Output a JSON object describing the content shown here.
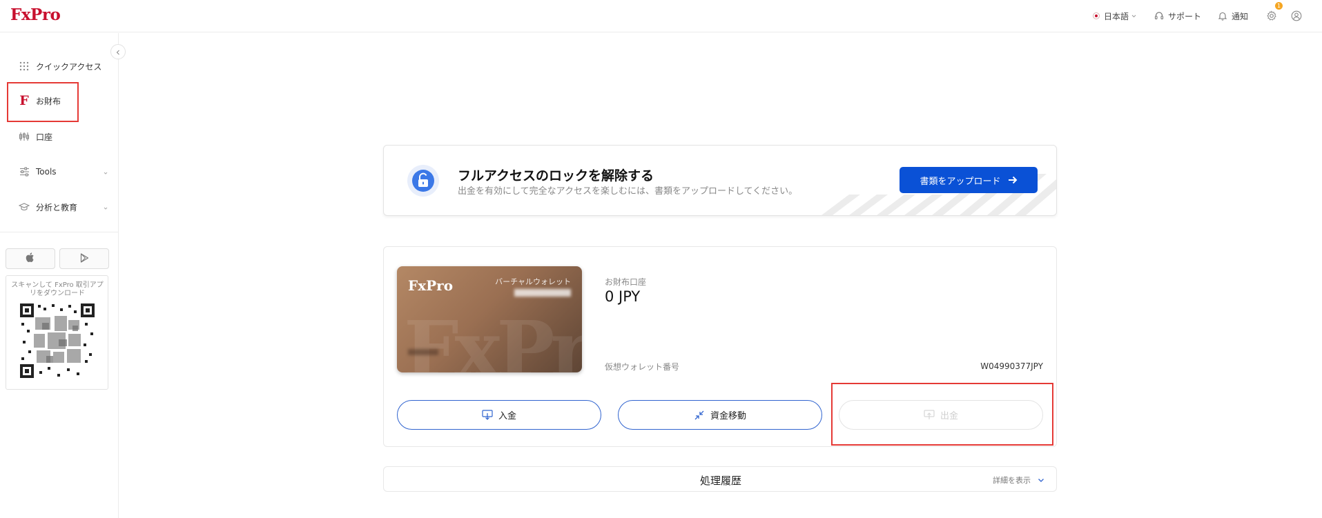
{
  "header": {
    "logo": "FxPro",
    "language": "日本語",
    "support": "サポート",
    "notifications": "通知",
    "settings_badge": "1"
  },
  "sidebar": {
    "items": [
      {
        "label": "クイックアクセス"
      },
      {
        "label": "お財布"
      },
      {
        "label": "口座"
      },
      {
        "label": "Tools"
      },
      {
        "label": "分析と教育"
      }
    ],
    "qr_text": "スキャンして FxPro 取引アプリをダウンロード"
  },
  "banner": {
    "title": "フルアクセスのロックを解除する",
    "subtitle": "出金を有効にして完全なアクセスを楽しむには、書類をアップロードしてください。",
    "button": "書類をアップロード"
  },
  "wallet": {
    "card_logo": "FxPro",
    "card_watermark": "FxPro",
    "card_label": "バーチャルウォレット",
    "account_label": "お財布口座",
    "balance": "0 JPY",
    "virtual_label": "仮想ウォレット番号",
    "virtual_number": "W04990377JPY",
    "actions": {
      "deposit": "入金",
      "transfer": "資金移動",
      "withdraw": "出金"
    }
  },
  "history": {
    "title": "処理履歴",
    "more": "詳細を表示"
  },
  "colors": {
    "brand": "#c8102e",
    "primary": "#0a51d6",
    "highlight": "#e53935"
  }
}
